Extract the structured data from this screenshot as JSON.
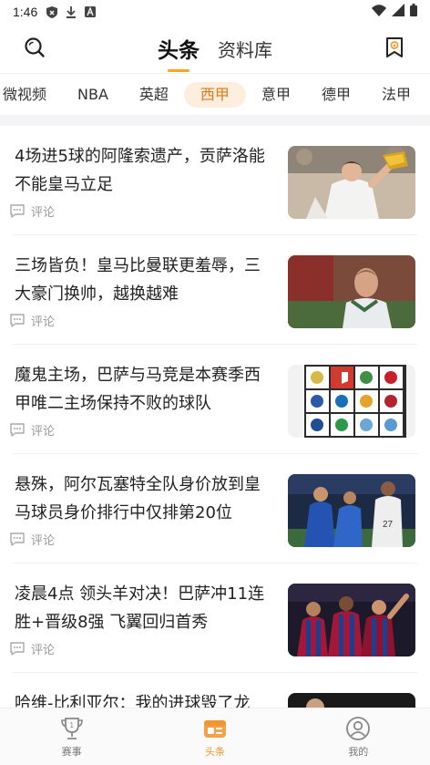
{
  "status_bar": {
    "time": "1:46"
  },
  "header": {
    "tabs": [
      {
        "label": "头条",
        "active": true
      },
      {
        "label": "资料库",
        "active": false
      }
    ]
  },
  "categories": [
    {
      "label": "微视频",
      "active": false
    },
    {
      "label": "NBA",
      "active": false
    },
    {
      "label": "英超",
      "active": false
    },
    {
      "label": "西甲",
      "active": true
    },
    {
      "label": "意甲",
      "active": false
    },
    {
      "label": "德甲",
      "active": false
    },
    {
      "label": "法甲",
      "active": false
    }
  ],
  "articles": [
    {
      "title": "4场进5球的阿隆索遗产，贡萨洛能不能皇马立足",
      "comment_label": "评论",
      "image": "player-celebrating-with-golden-boot"
    },
    {
      "title": "三场皆负！皇马比曼联更羞辱，三大豪门换帅，越换越难",
      "comment_label": "评论",
      "image": "coach-portrait-stadium"
    },
    {
      "title": "魔鬼主场，巴萨与马竞是本赛季西甲唯二主场保持不败的球队",
      "comment_label": "评论",
      "image": "laliga-club-badges-grid"
    },
    {
      "title": "悬殊，阿尔瓦塞特全队身价放到皇马球员身价排行中仅排第20位",
      "comment_label": "评论",
      "image": "players-match-action"
    },
    {
      "title": "凌晨4点 领头羊对决！巴萨冲11连胜+晋级8强 飞翼回归首秀",
      "comment_label": "评论",
      "image": "barcelona-players-celebrating"
    },
    {
      "title": "哈维-比利亚尔：我的进球毁了龙",
      "comment_label": "",
      "image": "partial-thumbnail"
    }
  ],
  "bottom_nav": [
    {
      "label": "赛事",
      "icon": "trophy-icon",
      "active": false
    },
    {
      "label": "头条",
      "icon": "news-icon",
      "active": true
    },
    {
      "label": "我的",
      "icon": "profile-icon",
      "active": false
    }
  ],
  "colors": {
    "accent": "#f0962e",
    "category_active_bg": "#fdeedd",
    "category_active_text": "#e0791a"
  }
}
